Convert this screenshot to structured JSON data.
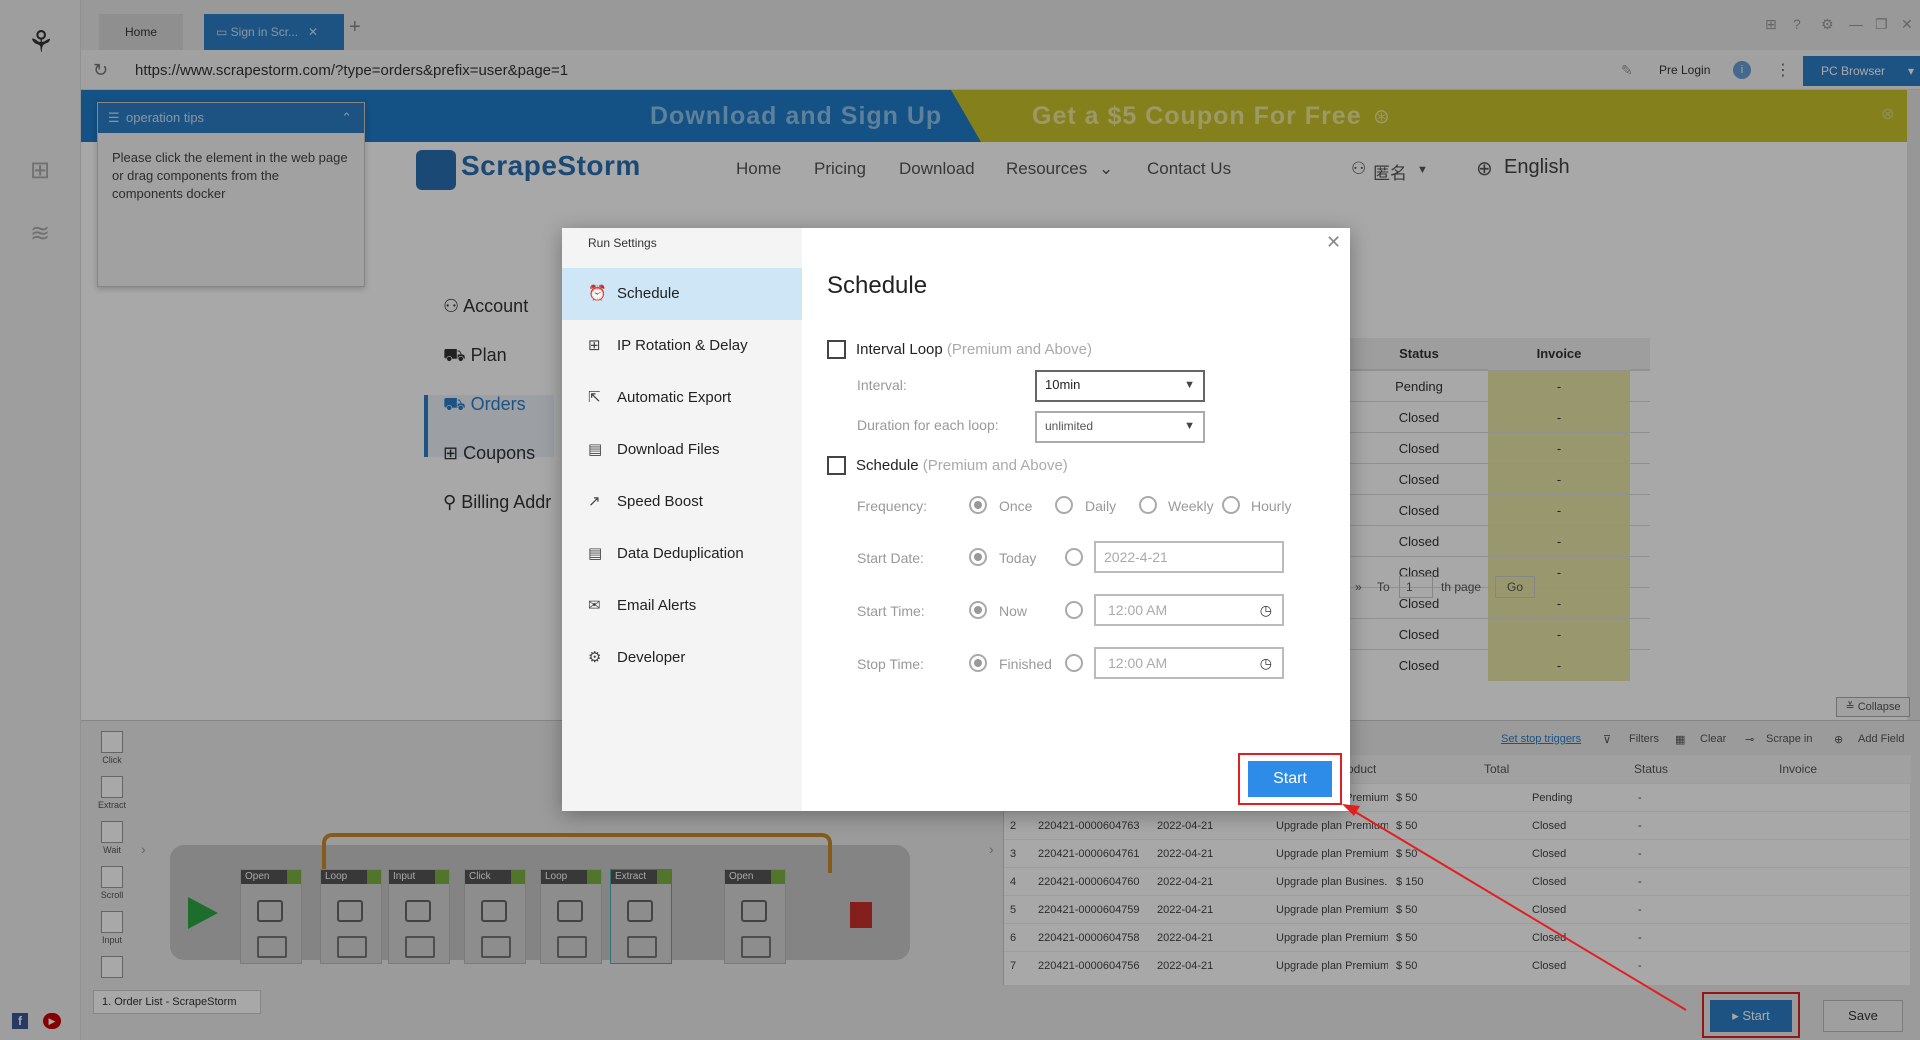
{
  "browser": {
    "tabs": [
      {
        "label": "Home"
      },
      {
        "label": "Sign in Scr..."
      }
    ],
    "url": "https://www.scrapestorm.com/?type=orders&prefix=user&page=1",
    "pre_login": "Pre Login",
    "pc_browser": "PC Browser"
  },
  "web": {
    "banner_left": "Download and Sign Up",
    "banner_right": "Get a $5 Coupon For Free",
    "brand": "ScrapeStorm",
    "nav": [
      "Home",
      "Pricing",
      "Download",
      "Resources",
      "Contact Us"
    ],
    "user": "匿名",
    "language": "English",
    "account_menu": [
      "Account",
      "Plan",
      "Orders",
      "Coupons",
      "Billing Addr"
    ],
    "table": {
      "headers": [
        "Status",
        "Invoice"
      ],
      "rows": [
        [
          "Pending",
          "-"
        ],
        [
          "Closed",
          "-"
        ],
        [
          "Closed",
          "-"
        ],
        [
          "Closed",
          "-"
        ],
        [
          "Closed",
          "-"
        ],
        [
          "Closed",
          "-"
        ],
        [
          "Closed",
          "-"
        ],
        [
          "Closed",
          "-"
        ],
        [
          "Closed",
          "-"
        ],
        [
          "Closed",
          "-"
        ]
      ],
      "pager_to": "To",
      "pager_page": "1",
      "pager_th": "th page",
      "pager_go": "Go"
    }
  },
  "tips": {
    "title": "operation tips",
    "body": "Please click the element in the web page or drag components from the components docker"
  },
  "tools": [
    "Click",
    "Extract",
    "Wait",
    "Scroll",
    "Input"
  ],
  "flow_nodes": [
    "Open",
    "Loop",
    "Input",
    "Click",
    "Loop",
    "Extract",
    "Open"
  ],
  "data_toolbar": {
    "set_stop_triggers": "Set stop triggers",
    "filters": "Filters",
    "clear": "Clear",
    "scrape_in": "Scrape in",
    "add_field": "Add Field",
    "collapse": "Collapse"
  },
  "data_table": {
    "headers": [
      "",
      "",
      "",
      "oduct",
      "Total",
      "Status",
      "Invoice"
    ],
    "rows": [
      [
        "",
        "",
        "",
        "Upgrade plan Premium...",
        "$ 50",
        "Pending",
        "-"
      ],
      [
        "2",
        "220421-0000604763",
        "2022-04-21",
        "Upgrade plan Premium...",
        "$ 50",
        "Closed",
        "-"
      ],
      [
        "3",
        "220421-0000604761",
        "2022-04-21",
        "Upgrade plan Premium...",
        "$ 50",
        "Closed",
        "-"
      ],
      [
        "4",
        "220421-0000604760",
        "2022-04-21",
        "Upgrade plan Busines...",
        "$ 150",
        "Closed",
        "-"
      ],
      [
        "5",
        "220421-0000604759",
        "2022-04-21",
        "Upgrade plan Premium...",
        "$ 50",
        "Closed",
        "-"
      ],
      [
        "6",
        "220421-0000604758",
        "2022-04-21",
        "Upgrade plan Premium...",
        "$ 50",
        "Closed",
        "-"
      ],
      [
        "7",
        "220421-0000604756",
        "2022-04-21",
        "Upgrade plan Premium...",
        "$ 50",
        "Closed",
        "-"
      ]
    ]
  },
  "task_name": "1. Order List - ScrapeStorm",
  "bottom_buttons": {
    "start": "Start",
    "save": "Save"
  },
  "dialog": {
    "header": "Run Settings",
    "menu": [
      "Schedule",
      "IP Rotation & Delay",
      "Automatic Export",
      "Download Files",
      "Speed Boost",
      "Data Deduplication",
      "Email Alerts",
      "Developer"
    ],
    "title": "Schedule",
    "interval_loop": {
      "label": "Interval Loop",
      "note": "(Premium and Above)"
    },
    "interval": {
      "label": "Interval:",
      "value": "10min"
    },
    "duration": {
      "label": "Duration for each loop:",
      "value": "unlimited"
    },
    "schedule": {
      "label": "Schedule",
      "note": "(Premium and Above)"
    },
    "frequency": {
      "label": "Frequency:",
      "options": [
        "Once",
        "Daily",
        "Weekly",
        "Hourly"
      ]
    },
    "start_date": {
      "label": "Start Date:",
      "option": "Today",
      "value": "2022-4-21"
    },
    "start_time": {
      "label": "Start Time:",
      "option": "Now",
      "value": "12:00 AM"
    },
    "stop_time": {
      "label": "Stop Time:",
      "option": "Finished",
      "value": "12:00 AM"
    },
    "start_button": "Start"
  }
}
